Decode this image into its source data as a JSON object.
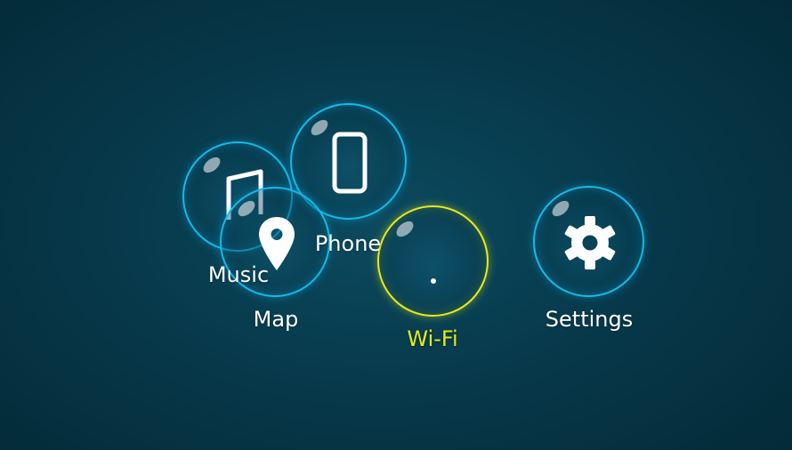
{
  "apps": [
    {
      "id": "music",
      "label": "Music",
      "icon": "music-note-icon",
      "active": false
    },
    {
      "id": "phone",
      "label": "Phone",
      "icon": "phone-icon",
      "active": false
    },
    {
      "id": "map",
      "label": "Map",
      "icon": "map-pin-icon",
      "active": false
    },
    {
      "id": "wifi",
      "label": "Wi-Fi",
      "icon": "wifi-icon",
      "active": true
    },
    {
      "id": "settings",
      "label": "Settings",
      "icon": "gear-icon",
      "active": false
    }
  ],
  "colors": {
    "bubble_border": "#17b8e6",
    "active": "#e6ec1b",
    "text": "#ffffff",
    "background": "#073a4c"
  }
}
